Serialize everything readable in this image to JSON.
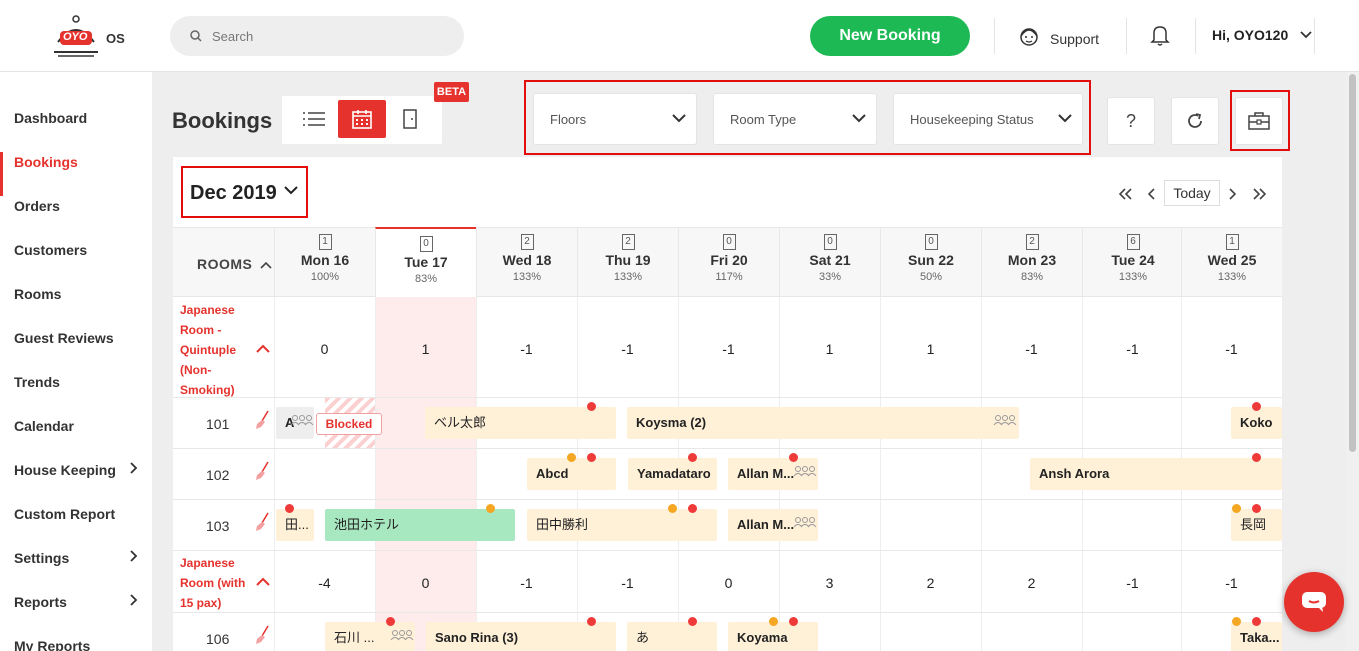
{
  "brand": {
    "logo_text": "OYO",
    "logo_suffix": "OS"
  },
  "search": {
    "placeholder": "Search"
  },
  "header": {
    "new_booking": "New Booking",
    "support": "Support",
    "user_greeting": "Hi, OYO120"
  },
  "sidebar": {
    "items": [
      {
        "label": "Dashboard"
      },
      {
        "label": "Bookings",
        "active": true
      },
      {
        "label": "Orders"
      },
      {
        "label": "Customers"
      },
      {
        "label": "Rooms"
      },
      {
        "label": "Guest Reviews"
      },
      {
        "label": "Trends"
      },
      {
        "label": "Calendar"
      },
      {
        "label": "House Keeping",
        "expandable": true
      },
      {
        "label": "Custom Report"
      },
      {
        "label": "Settings",
        "expandable": true
      },
      {
        "label": "Reports",
        "expandable": true
      },
      {
        "label": "My Reports"
      }
    ]
  },
  "page": {
    "title": "Bookings",
    "beta_badge": "BETA",
    "view_modes": [
      "list-icon",
      "calendar-icon",
      "door-icon"
    ],
    "active_view": "calendar"
  },
  "filters": {
    "floors": "Floors",
    "room_type": "Room Type",
    "housekeeping": "Housekeeping Status"
  },
  "toolbar": {
    "help": "?",
    "refresh_icon": "refresh-icon",
    "briefcase_icon": "briefcase-icon"
  },
  "calendar": {
    "month": "Dec 2019",
    "today_button": "Today",
    "rooms_header": "ROOMS",
    "days": [
      {
        "name": "Mon 16",
        "count": "1",
        "pct": "100%"
      },
      {
        "name": "Tue 17",
        "count": "0",
        "pct": "83%",
        "today": true
      },
      {
        "name": "Wed 18",
        "count": "2",
        "pct": "133%"
      },
      {
        "name": "Thu 19",
        "count": "2",
        "pct": "133%"
      },
      {
        "name": "Fri 20",
        "count": "0",
        "pct": "117%"
      },
      {
        "name": "Sat 21",
        "count": "0",
        "pct": "33%"
      },
      {
        "name": "Sun 22",
        "count": "0",
        "pct": "50%"
      },
      {
        "name": "Mon 23",
        "count": "2",
        "pct": "83%"
      },
      {
        "name": "Tue 24",
        "count": "6",
        "pct": "133%"
      },
      {
        "name": "Wed 25",
        "count": "1",
        "pct": "133%"
      }
    ],
    "room_types": [
      {
        "name": "Japanese Room - Quintuple (Non-Smoking)",
        "lines": [
          "Japanese",
          "Room -",
          "Quintuple",
          "(Non-",
          "Smoking)"
        ],
        "availability": [
          "0",
          "1",
          "-1",
          "-1",
          "-1",
          "1",
          "1",
          "-1",
          "-1",
          "-1"
        ]
      },
      {
        "name": "Japanese Room (with 15 pax)",
        "lines": [
          "Japanese",
          "Room (with",
          "15 pax)"
        ],
        "availability": [
          "-4",
          "0",
          "-1",
          "-1",
          "0",
          "3",
          "2",
          "2",
          "-1",
          "-1"
        ]
      }
    ],
    "rooms": [
      "101",
      "102",
      "103",
      "106"
    ],
    "blocked_label": "Blocked",
    "bookings": [
      {
        "room": "101",
        "guest": "A"
      },
      {
        "room": "101",
        "guest": "ベル太郎"
      },
      {
        "room": "101",
        "guest": "Koysma",
        "count": "(2)"
      },
      {
        "room": "101",
        "guest": "Koko"
      },
      {
        "room": "102",
        "guest": "Abcd"
      },
      {
        "room": "102",
        "guest": "Yamadataro"
      },
      {
        "room": "102",
        "guest": "Allan M..."
      },
      {
        "room": "102",
        "guest": "Ansh Arora"
      },
      {
        "room": "103",
        "guest": "田..."
      },
      {
        "room": "103",
        "guest": "池田ホテル"
      },
      {
        "room": "103",
        "guest": "田中勝利"
      },
      {
        "room": "103",
        "guest": "Allan M..."
      },
      {
        "room": "103",
        "guest": "長岡"
      },
      {
        "room": "106",
        "guest": "石川 ..."
      },
      {
        "room": "106",
        "guest": "Sano Rina",
        "count": "(3)"
      },
      {
        "room": "106",
        "guest": "あ"
      },
      {
        "room": "106",
        "guest": "Koyama"
      },
      {
        "room": "106",
        "guest": "Taka..."
      }
    ]
  },
  "colors": {
    "brand_red": "#e5322d",
    "new_booking_green": "#1db954",
    "booking_bg": "#fff0d8",
    "checked_in_bg": "#a8e8c0",
    "highlight_box": "#e20e0e"
  }
}
